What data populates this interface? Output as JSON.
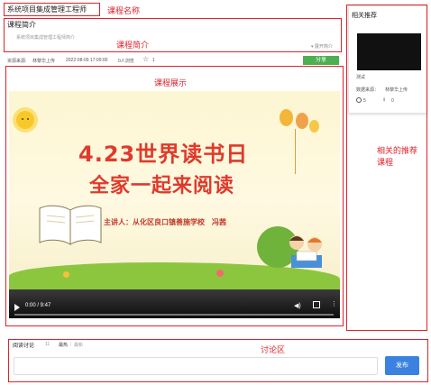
{
  "header": {
    "course_title": "系统项目集成管理工程师",
    "annotation_course_name": "课程名称"
  },
  "intro": {
    "heading": "课程简介",
    "text": "系统项目集成管理工程师简介",
    "annotation": "课程简介",
    "expand_label": "▾ 展开简介"
  },
  "meta": {
    "source_label": "资源来源:",
    "uploader": "林黎华上传",
    "datetime": "2022-08-09 17:09:00",
    "views": "0人浏览",
    "likes": "1",
    "share_label": "分享"
  },
  "video": {
    "annotation": "课程展示",
    "poster_title_line1": "4.23世界读书日",
    "poster_title_line2": "全家一起来阅读",
    "poster_speaker": "主讲人：从化区良口镇善施学校　冯茜",
    "time": "0:00 / 9:47"
  },
  "sidebar": {
    "title": "相关推荐",
    "item_title": "测试",
    "item_source_label": "数据来源：",
    "item_uploader": "林黎华上传",
    "item_plays": "5",
    "item_downloads": "0",
    "annotation_line1": "相关的推荐",
    "annotation_line2": "课程"
  },
  "discussion": {
    "title": "阅读讨论",
    "count": "11",
    "sort_newest": "最热",
    "sort_latest": "最新",
    "annotation": "讨论区",
    "submit_label": "发布",
    "input_placeholder": ""
  },
  "colors": {
    "annotation_red": "#e0222c",
    "share_green": "#4caf50",
    "submit_blue": "#3b82e0",
    "poster_title_red": "#e03a2c"
  }
}
